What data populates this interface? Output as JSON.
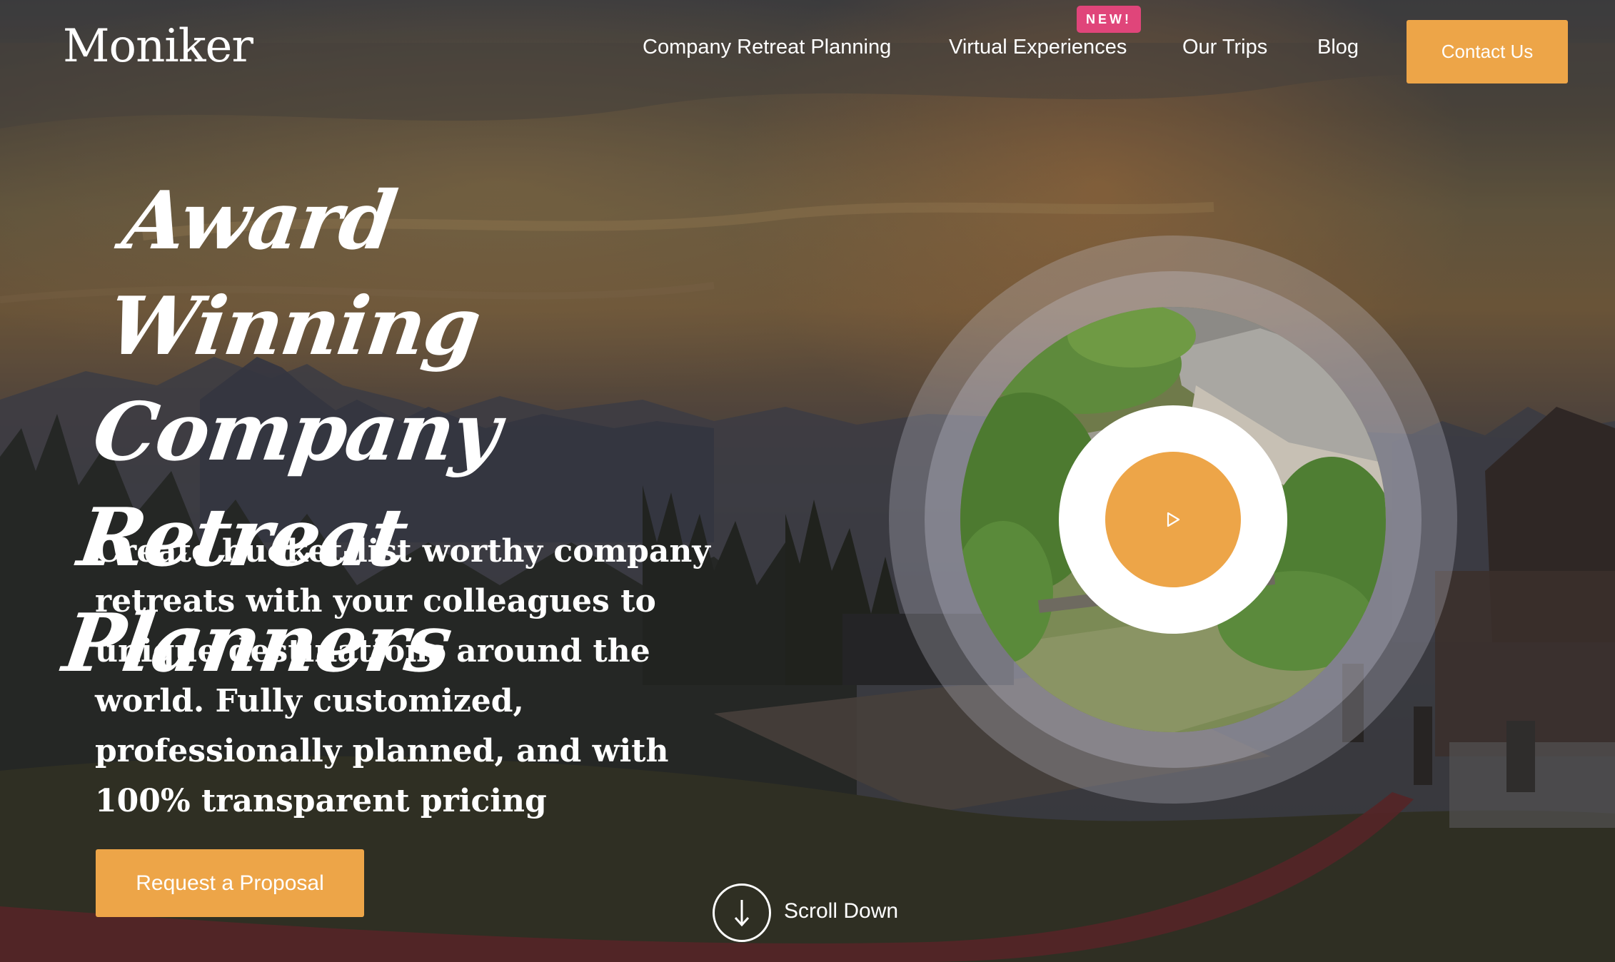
{
  "header": {
    "logo": "Moniker",
    "nav": [
      {
        "label": "Company Retreat Planning"
      },
      {
        "label": "Virtual Experiences",
        "badge": "NEW!"
      },
      {
        "label": "Our Trips"
      },
      {
        "label": "Blog"
      }
    ],
    "contact_label": "Contact Us"
  },
  "hero": {
    "headline_lines": [
      "Award Winning",
      "Company Retreat",
      "Planners"
    ],
    "lede": "Create bucket-list worthy company retreats with your colleagues to unique destinations around the world. Fully customized, professionally planned, and with 100% transparent pricing",
    "cta_label": "Request a Proposal",
    "scroll_label": "Scroll Down"
  },
  "icons": {
    "play": "play-icon",
    "scroll": "arrow-down-icon"
  },
  "colors": {
    "accent": "#eda548",
    "badge": "#e0457a",
    "text": "#ffffff"
  }
}
